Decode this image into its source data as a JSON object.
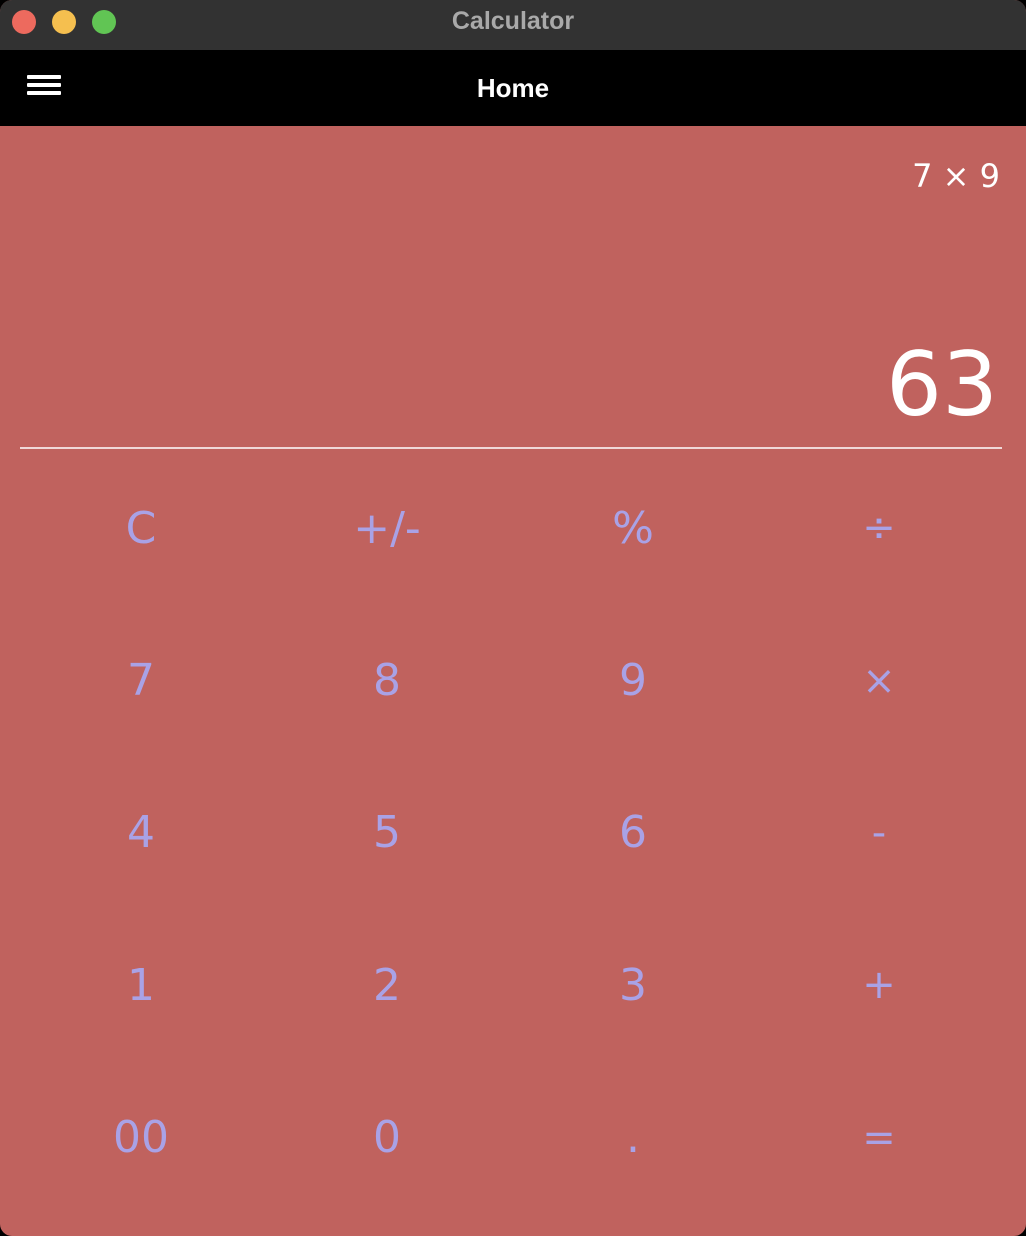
{
  "window": {
    "title": "Calculator"
  },
  "appbar": {
    "title": "Home",
    "menu_icon": "hamburger-menu-icon"
  },
  "display": {
    "expression": "7 × 9",
    "result": "63"
  },
  "keypad": {
    "rows": [
      [
        "C",
        "+/-",
        "%",
        "÷"
      ],
      [
        "7",
        "8",
        "9",
        "×"
      ],
      [
        "4",
        "5",
        "6",
        "-"
      ],
      [
        "1",
        "2",
        "3",
        "+"
      ],
      [
        "00",
        "0",
        ".",
        "="
      ]
    ]
  },
  "colors": {
    "background": "#c0625e",
    "key_text": "#a9a2e6",
    "display_text": "#ffffff",
    "appbar": "#000000",
    "titlebar": "#323232"
  }
}
